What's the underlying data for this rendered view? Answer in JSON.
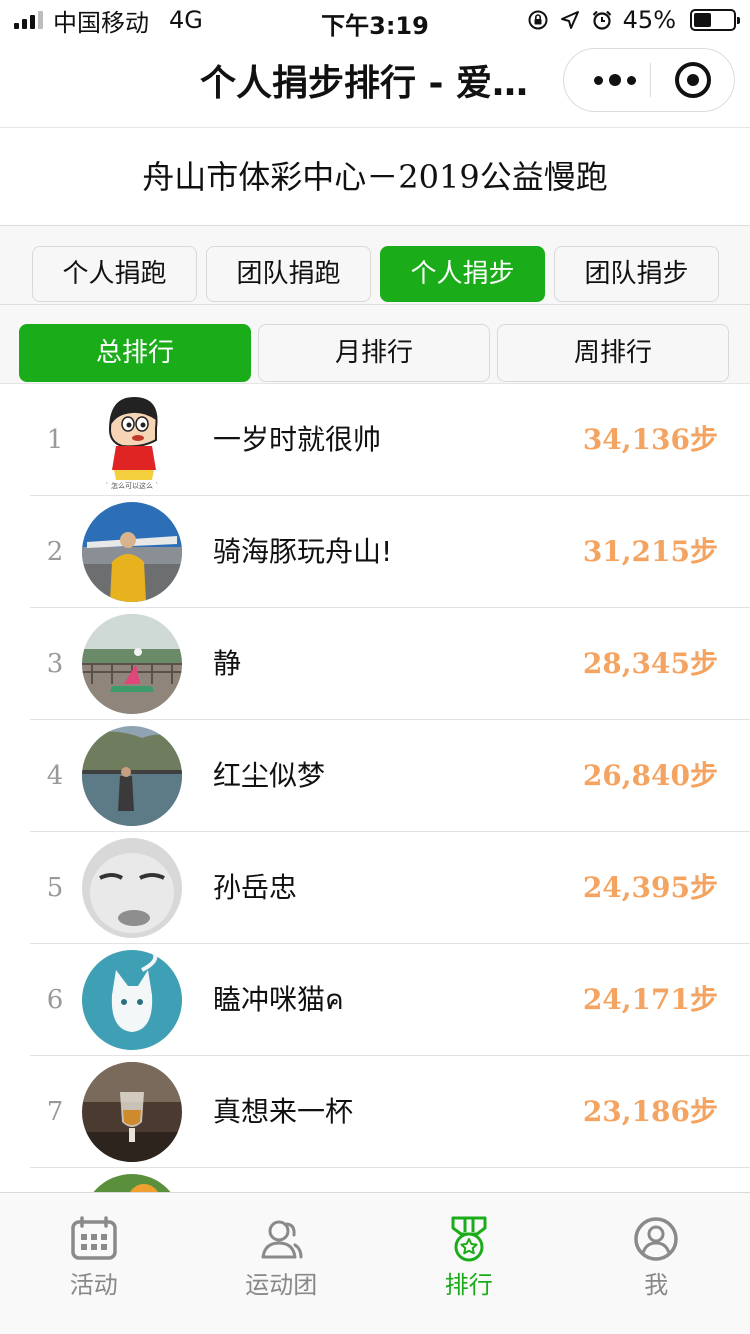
{
  "status_bar": {
    "carrier": "中国移动",
    "network": "4G",
    "time": "下午3:19",
    "battery": "45%",
    "battery_level": 0.45
  },
  "nav": {
    "title": "个人捐步排行 - 爱…"
  },
  "event": {
    "title": "舟山市体彩中心－2019公益慢跑"
  },
  "category_tabs": [
    {
      "label": "个人捐跑",
      "active": false
    },
    {
      "label": "团队捐跑",
      "active": false
    },
    {
      "label": "个人捐步",
      "active": true
    },
    {
      "label": "团队捐步",
      "active": false
    }
  ],
  "period_tabs": [
    {
      "label": "总排行",
      "active": true
    },
    {
      "label": "月排行",
      "active": false
    },
    {
      "label": "周排行",
      "active": false
    }
  ],
  "ranking": [
    {
      "rank": "1",
      "name": "一岁时就很帅",
      "steps": "34,136步",
      "avatar": "cartoon-boy-avatar"
    },
    {
      "rank": "2",
      "name": "骑海豚玩舟山!",
      "steps": "31,215步",
      "avatar": "airport-photo-avatar"
    },
    {
      "rank": "3",
      "name": "静",
      "steps": "28,345步",
      "avatar": "yoga-photo-avatar"
    },
    {
      "rank": "4",
      "name": "红尘似梦",
      "steps": "26,840步",
      "avatar": "lake-photo-avatar"
    },
    {
      "rank": "5",
      "name": "孙岳忠",
      "steps": "24,395步",
      "avatar": "baby-face-avatar"
    },
    {
      "rank": "6",
      "name": "瞌冲咪猫ค",
      "steps": "24,171步",
      "avatar": "white-cat-avatar"
    },
    {
      "rank": "7",
      "name": "真想来一杯",
      "steps": "23,186步",
      "avatar": "whisky-glass-avatar"
    },
    {
      "rank": "",
      "name": "",
      "steps": "",
      "avatar": "partial-avatar"
    }
  ],
  "tab_bar": [
    {
      "label": "活动",
      "icon": "calendar-icon",
      "active": false
    },
    {
      "label": "运动团",
      "icon": "group-icon",
      "active": false
    },
    {
      "label": "排行",
      "icon": "medal-icon",
      "active": true
    },
    {
      "label": "我",
      "icon": "profile-icon",
      "active": false
    }
  ],
  "colors": {
    "accent_green": "#1aad19",
    "steps_orange": "#f4a460",
    "rank_gray": "#999999"
  }
}
